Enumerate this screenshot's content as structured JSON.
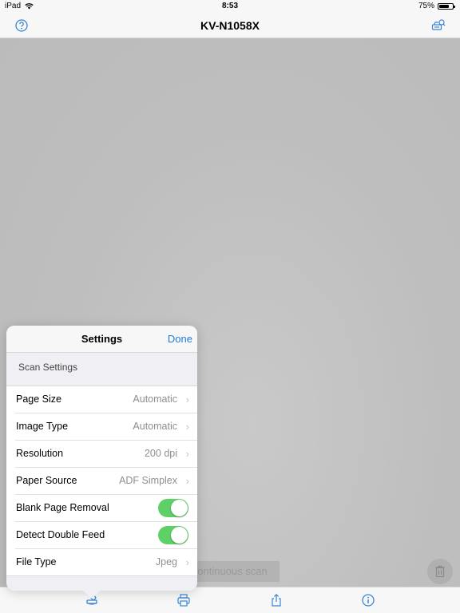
{
  "status_bar": {
    "carrier": "iPad",
    "time": "8:53",
    "battery_text": "75%",
    "battery_level": 0.75
  },
  "nav": {
    "title": "KV-N1058X",
    "left_icon": "help-icon",
    "right_icon": "scanner-search-icon"
  },
  "preview": {
    "continuous_scan_label": "ontinuous scan",
    "trash_icon": "trash-icon"
  },
  "popover": {
    "title": "Settings",
    "done_label": "Done",
    "section_title": "Scan Settings",
    "rows": [
      {
        "label": "Page Size",
        "value": "Automatic",
        "type": "disclosure"
      },
      {
        "label": "Image Type",
        "value": "Automatic",
        "type": "disclosure"
      },
      {
        "label": "Resolution",
        "value": "200 dpi",
        "type": "disclosure"
      },
      {
        "label": "Paper Source",
        "value": "ADF Simplex",
        "type": "disclosure"
      },
      {
        "label": "Blank Page Removal",
        "value": "on",
        "type": "toggle"
      },
      {
        "label": "Detect Double Feed",
        "value": "on",
        "type": "toggle"
      },
      {
        "label": "File Type",
        "value": "Jpeg",
        "type": "disclosure"
      }
    ],
    "chevron": "›"
  },
  "toolbar": {
    "items": [
      "scan-settings-icon",
      "print-icon",
      "share-icon",
      "info-icon"
    ]
  },
  "colors": {
    "accent": "#1f7bd8",
    "toggle_on": "#5fd068",
    "icon": "#3a86d4"
  }
}
